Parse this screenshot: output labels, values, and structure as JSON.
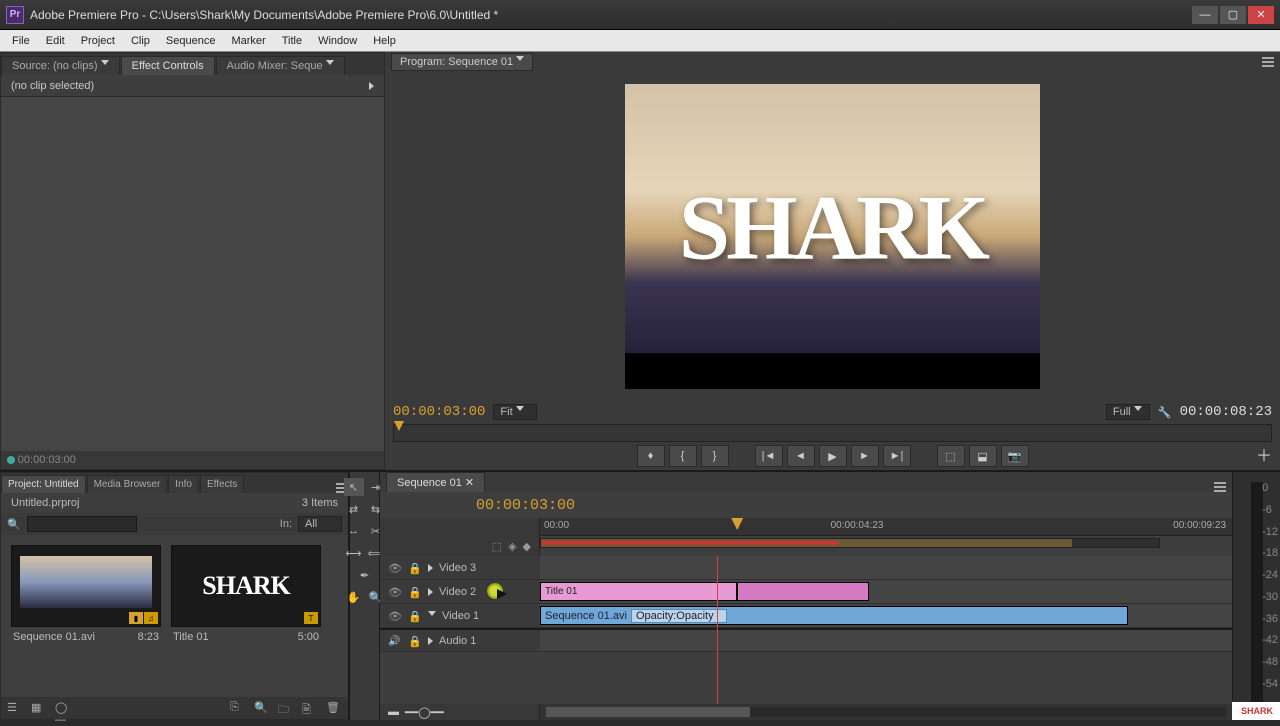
{
  "window": {
    "app_badge": "Pr",
    "title": "Adobe Premiere Pro - C:\\Users\\Shark\\My Documents\\Adobe Premiere Pro\\6.0\\Untitled *"
  },
  "menu": [
    "File",
    "Edit",
    "Project",
    "Clip",
    "Sequence",
    "Marker",
    "Title",
    "Window",
    "Help"
  ],
  "source_panel": {
    "tabs": [
      {
        "label": "Source: (no clips)",
        "active": false
      },
      {
        "label": "Effect Controls",
        "active": true
      },
      {
        "label": "Audio Mixer: Seque",
        "active": false
      }
    ],
    "no_clip": "(no clip selected)",
    "footer_tc": "00:00:03:00"
  },
  "program": {
    "tab": "Program: Sequence 01",
    "overlay_text": "SHARK",
    "tc_left": "00:00:03:00",
    "fit": "Fit",
    "full": "Full",
    "tc_right": "00:00:08:23"
  },
  "project_panel": {
    "tabs": [
      "Project: Untitled",
      "Media Browser",
      "Info",
      "Effects"
    ],
    "file": "Untitled.prproj",
    "count": "3 Items",
    "in_label": "In:",
    "in_value": "All",
    "bins": [
      {
        "name": "Sequence 01.avi",
        "dur": "8:23"
      },
      {
        "name": "Title 01",
        "dur": "5:00"
      }
    ]
  },
  "timeline": {
    "tab": "Sequence 01",
    "tc": "00:00:03:00",
    "ruler": {
      "t0": "00:00",
      "t1": "00:00:04:23",
      "t2": "00:00:09:23"
    },
    "tracks": {
      "v3": "Video 3",
      "v2": "Video 2",
      "v1": "Video 1",
      "a1": "Audio 1"
    },
    "clips": {
      "title": "Title 01",
      "seq_name": "Sequence 01.avi",
      "seq_fx": "Opacity:Opacity"
    }
  },
  "meter": {
    "ticks": [
      "0",
      "-6",
      "-12",
      "-18",
      "-24",
      "-30",
      "-36",
      "-42",
      "-48",
      "-54"
    ],
    "logo": "SHARK"
  }
}
